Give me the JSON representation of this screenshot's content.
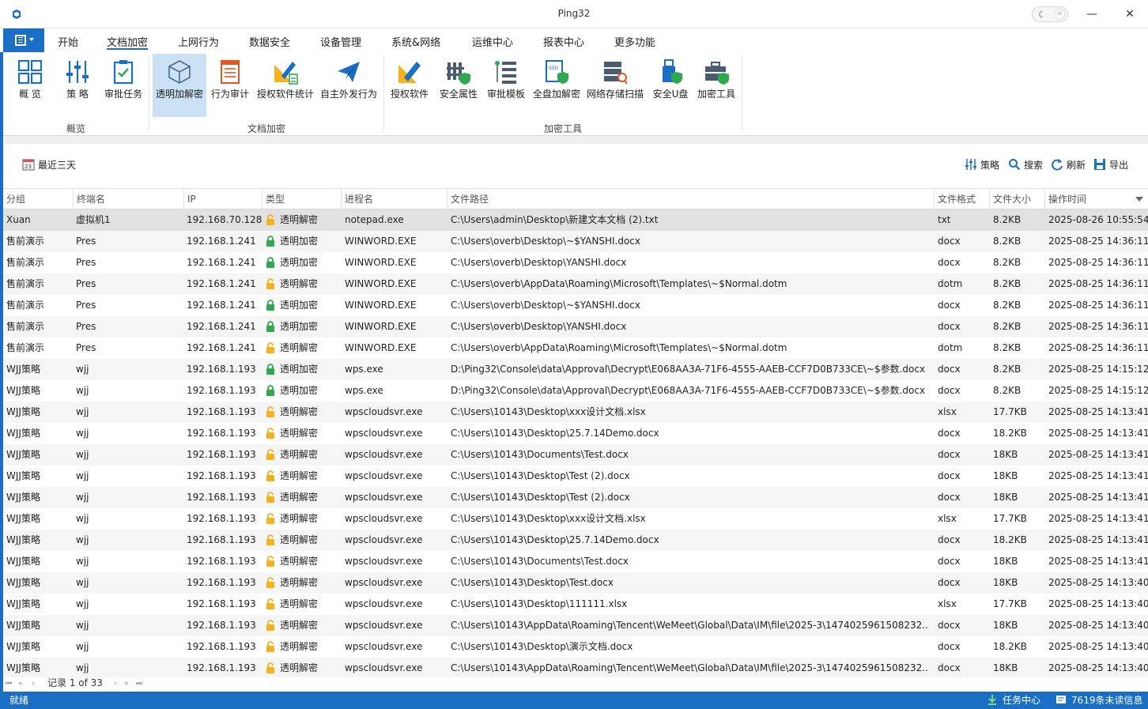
{
  "window": {
    "title": "Ping32",
    "minimize": "—",
    "maximize": "☐",
    "close": "✕"
  },
  "tabs": [
    "开始",
    "文档加密",
    "上网行为",
    "数据安全",
    "设备管理",
    "系统&网络",
    "运维中心",
    "报表中心",
    "更多功能"
  ],
  "ribbon": {
    "buttons": [
      {
        "label": "概 览",
        "icon": "dashboard-icon"
      },
      {
        "label": "策 略",
        "icon": "sliders-icon"
      },
      {
        "label": "审批任务",
        "icon": "approval-clipboard-icon"
      },
      {
        "label": "透明加解密",
        "icon": "cube-icon"
      },
      {
        "label": "行为审计",
        "icon": "document-list-icon"
      },
      {
        "label": "授权软件统计",
        "icon": "ruler-pencil-chart-icon"
      },
      {
        "label": "自主外发行为",
        "icon": "paper-plane-icon"
      },
      {
        "label": "授权软件",
        "icon": "ruler-pencil-icon"
      },
      {
        "label": "安全属性",
        "icon": "shield-fence-icon"
      },
      {
        "label": "审批模板",
        "icon": "tree-list-icon"
      },
      {
        "label": "全盘加解密",
        "icon": "ssd-shield-icon"
      },
      {
        "label": "网络存储扫描",
        "icon": "server-scan-icon"
      },
      {
        "label": "安全U盘",
        "icon": "usb-shield-icon"
      },
      {
        "label": "加密工具",
        "icon": "toolbox-shield-icon"
      }
    ],
    "groups": [
      "概览",
      "文档加密",
      "加密工具"
    ]
  },
  "toolbar": {
    "date_filter": "最近三天",
    "date_icon_text": "23",
    "policy": "策略",
    "search": "搜索",
    "refresh": "刷新",
    "export": "导出"
  },
  "table": {
    "columns": [
      "分组",
      "终端名",
      "IP",
      "类型",
      "进程名",
      "文件路径",
      "文件格式",
      "文件大小",
      "操作时间"
    ],
    "rows": [
      [
        "Xuan",
        "虚拟机1",
        "192.168.70.128",
        "透明解密",
        "notepad.exe",
        "C:\\Users\\admin\\Desktop\\新建文本文档 (2).txt",
        "txt",
        "8.2KB",
        "2025-08-26 10:55:54"
      ],
      [
        "售前演示",
        "Pres",
        "192.168.1.241",
        "透明加密",
        "WINWORD.EXE",
        "C:\\Users\\overb\\Desktop\\~$YANSHI.docx",
        "docx",
        "8.2KB",
        "2025-08-25 14:36:11"
      ],
      [
        "售前演示",
        "Pres",
        "192.168.1.241",
        "透明加密",
        "WINWORD.EXE",
        "C:\\Users\\overb\\Desktop\\YANSHI.docx",
        "docx",
        "8.2KB",
        "2025-08-25 14:36:11"
      ],
      [
        "售前演示",
        "Pres",
        "192.168.1.241",
        "透明解密",
        "WINWORD.EXE",
        "C:\\Users\\overb\\AppData\\Roaming\\Microsoft\\Templates\\~$Normal.dotm",
        "dotm",
        "8.2KB",
        "2025-08-25 14:36:11"
      ],
      [
        "售前演示",
        "Pres",
        "192.168.1.241",
        "透明加密",
        "WINWORD.EXE",
        "C:\\Users\\overb\\Desktop\\~$YANSHI.docx",
        "docx",
        "8.2KB",
        "2025-08-25 14:36:11"
      ],
      [
        "售前演示",
        "Pres",
        "192.168.1.241",
        "透明加密",
        "WINWORD.EXE",
        "C:\\Users\\overb\\Desktop\\YANSHI.docx",
        "docx",
        "8.2KB",
        "2025-08-25 14:36:11"
      ],
      [
        "售前演示",
        "Pres",
        "192.168.1.241",
        "透明解密",
        "WINWORD.EXE",
        "C:\\Users\\overb\\AppData\\Roaming\\Microsoft\\Templates\\~$Normal.dotm",
        "dotm",
        "8.2KB",
        "2025-08-25 14:36:11"
      ],
      [
        "WJJ策略",
        "wjj",
        "192.168.1.193",
        "透明加密",
        "wps.exe",
        "D:\\Ping32\\Console\\data\\Approval\\Decrypt\\E068AA3A-71F6-4555-AAEB-CCF7D0B733CE\\~$参数.docx",
        "docx",
        "8.2KB",
        "2025-08-25 14:15:12"
      ],
      [
        "WJJ策略",
        "wjj",
        "192.168.1.193",
        "透明加密",
        "wps.exe",
        "D:\\Ping32\\Console\\data\\Approval\\Decrypt\\E068AA3A-71F6-4555-AAEB-CCF7D0B733CE\\~$参数.docx",
        "docx",
        "8.2KB",
        "2025-08-25 14:15:12"
      ],
      [
        "WJJ策略",
        "wjj",
        "192.168.1.193",
        "透明解密",
        "wpscloudsvr.exe",
        "C:\\Users\\10143\\Desktop\\xxx设计文档.xlsx",
        "xlsx",
        "17.7KB",
        "2025-08-25 14:13:41"
      ],
      [
        "WJJ策略",
        "wjj",
        "192.168.1.193",
        "透明解密",
        "wpscloudsvr.exe",
        "C:\\Users\\10143\\Desktop\\25.7.14Demo.docx",
        "docx",
        "18.2KB",
        "2025-08-25 14:13:41"
      ],
      [
        "WJJ策略",
        "wjj",
        "192.168.1.193",
        "透明解密",
        "wpscloudsvr.exe",
        "C:\\Users\\10143\\Documents\\Test.docx",
        "docx",
        "18KB",
        "2025-08-25 14:13:41"
      ],
      [
        "WJJ策略",
        "wjj",
        "192.168.1.193",
        "透明解密",
        "wpscloudsvr.exe",
        "C:\\Users\\10143\\Desktop\\Test (2).docx",
        "docx",
        "18KB",
        "2025-08-25 14:13:41"
      ],
      [
        "WJJ策略",
        "wjj",
        "192.168.1.193",
        "透明解密",
        "wpscloudsvr.exe",
        "C:\\Users\\10143\\Desktop\\Test (2).docx",
        "docx",
        "18KB",
        "2025-08-25 14:13:41"
      ],
      [
        "WJJ策略",
        "wjj",
        "192.168.1.193",
        "透明解密",
        "wpscloudsvr.exe",
        "C:\\Users\\10143\\Desktop\\xxx设计文档.xlsx",
        "xlsx",
        "17.7KB",
        "2025-08-25 14:13:41"
      ],
      [
        "WJJ策略",
        "wjj",
        "192.168.1.193",
        "透明解密",
        "wpscloudsvr.exe",
        "C:\\Users\\10143\\Desktop\\25.7.14Demo.docx",
        "docx",
        "18.2KB",
        "2025-08-25 14:13:41"
      ],
      [
        "WJJ策略",
        "wjj",
        "192.168.1.193",
        "透明解密",
        "wpscloudsvr.exe",
        "C:\\Users\\10143\\Documents\\Test.docx",
        "docx",
        "18KB",
        "2025-08-25 14:13:41"
      ],
      [
        "WJJ策略",
        "wjj",
        "192.168.1.193",
        "透明解密",
        "wpscloudsvr.exe",
        "C:\\Users\\10143\\Desktop\\Test.docx",
        "docx",
        "18KB",
        "2025-08-25 14:13:40"
      ],
      [
        "WJJ策略",
        "wjj",
        "192.168.1.193",
        "透明解密",
        "wpscloudsvr.exe",
        "C:\\Users\\10143\\Desktop\\111111.xlsx",
        "xlsx",
        "17.7KB",
        "2025-08-25 14:13:40"
      ],
      [
        "WJJ策略",
        "wjj",
        "192.168.1.193",
        "透明解密",
        "wpscloudsvr.exe",
        "C:\\Users\\10143\\AppData\\Roaming\\Tencent\\WeMeet\\Global\\Data\\IM\\file\\2025-3\\1474025961508232...",
        "docx",
        "18KB",
        "2025-08-25 14:13:40"
      ],
      [
        "WJJ策略",
        "wjj",
        "192.168.1.193",
        "透明解密",
        "wpscloudsvr.exe",
        "C:\\Users\\10143\\Desktop\\演示文档.docx",
        "docx",
        "18.2KB",
        "2025-08-25 14:13:40"
      ],
      [
        "WJJ策略",
        "wjj",
        "192.168.1.193",
        "透明解密",
        "wpscloudsvr.exe",
        "C:\\Users\\10143\\AppData\\Roaming\\Tencent\\WeMeet\\Global\\Data\\IM\\file\\2025-3\\1474025961508232...",
        "docx",
        "18KB",
        "2025-08-25 14:13:40"
      ]
    ]
  },
  "pager": {
    "text": "记录 1 of 33",
    "first": "⏮",
    "prev_page": "«",
    "prev": "‹",
    "next": "›",
    "next_page": "»",
    "last": "⏭"
  },
  "status": {
    "left": "就绪",
    "task_center": "任务中心",
    "unread": "7619条未读信息"
  },
  "colors": {
    "accent": "#1a6fc4",
    "encrypt_lock": "#2fa84f",
    "decrypt_lock": "#f5b21d",
    "selected_tab_bg": "#c9e0f5"
  }
}
